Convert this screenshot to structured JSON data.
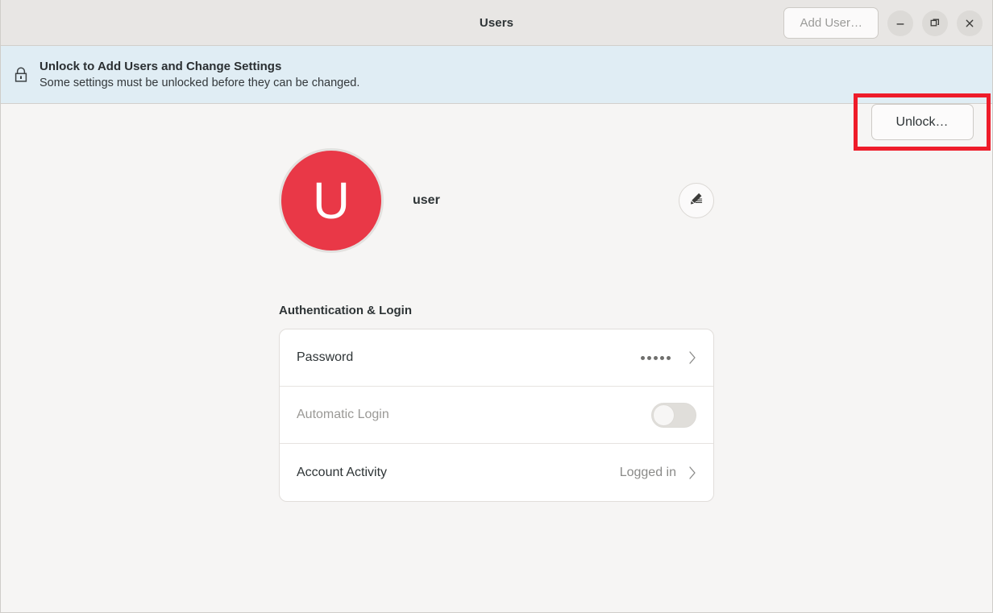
{
  "window": {
    "title": "Users",
    "add_user_label": "Add User…",
    "controls": {
      "minimize": "minimize-icon",
      "maximize": "maximize-icon",
      "close": "close-icon"
    }
  },
  "banner": {
    "lock_icon": "lock-closed-icon",
    "title": "Unlock to Add Users and Change Settings",
    "subtitle": "Some settings must be unlocked before they can be changed.",
    "unlock_label": "Unlock…",
    "highlight_color": "#ee1c2a",
    "background_color": "#e0edf4"
  },
  "user": {
    "avatar_initial": "U",
    "avatar_color": "#e93847",
    "name": "user",
    "edit_icon": "pencil-edit-icon"
  },
  "section": {
    "title": "Authentication & Login",
    "rows": [
      {
        "label": "Password",
        "value": "•••••",
        "control": "chevron",
        "disabled": false
      },
      {
        "label": "Automatic Login",
        "value": "",
        "control": "toggle",
        "toggle_state": "off",
        "disabled": true
      },
      {
        "label": "Account Activity",
        "value": "Logged in",
        "control": "chevron",
        "disabled": false
      }
    ]
  }
}
